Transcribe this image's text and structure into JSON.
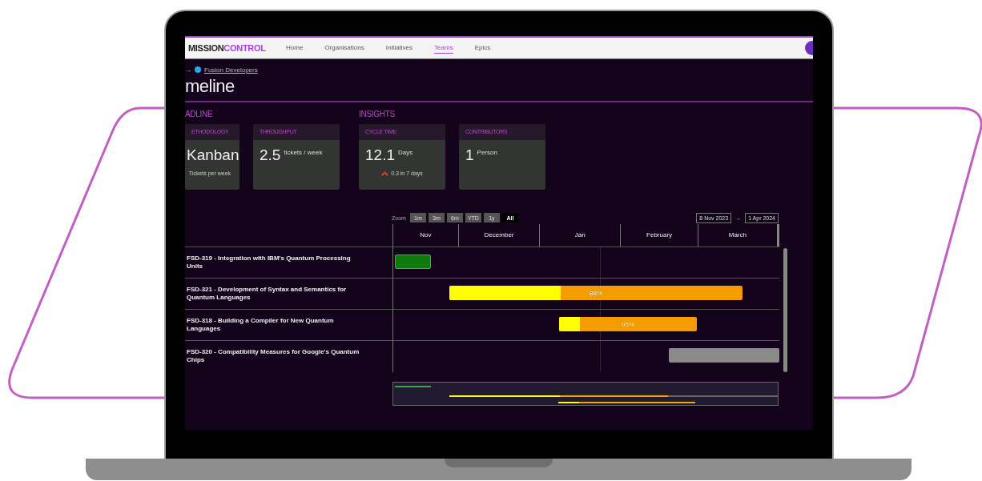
{
  "brand": {
    "first": "MISSION",
    "second": "CONTROL"
  },
  "nav": [
    {
      "label": "Home",
      "selected": false
    },
    {
      "label": "Organisations",
      "selected": false
    },
    {
      "label": "Initiatives",
      "selected": false
    },
    {
      "label": "Teams",
      "selected": true
    },
    {
      "label": "Epics",
      "selected": false
    }
  ],
  "breadcrumb": {
    "arrow": "→",
    "link": "Fusion Developers"
  },
  "page_title": "meline",
  "sections": [
    {
      "title": "ADLINE",
      "cards": [
        {
          "label": "ETHODOLOGY",
          "value": "Kanban",
          "note": "Tickets per week"
        },
        {
          "label": "THROUGHPUT",
          "value": "2.5",
          "unit": "tickets / week"
        }
      ]
    },
    {
      "title": "INSIGHTS",
      "cards": [
        {
          "label": "CYCLE TIME",
          "value": "12.1",
          "unit": "Days",
          "note": "0.3 in 7 days",
          "rising": true
        },
        {
          "label": "CONTRIBUTORS",
          "value": "1",
          "unit": "Person"
        }
      ]
    }
  ],
  "zoom": {
    "label": "Zoom",
    "options": [
      {
        "label": "1m",
        "selected": false
      },
      {
        "label": "3m",
        "selected": false
      },
      {
        "label": "6m",
        "selected": false
      },
      {
        "label": "YTD",
        "selected": false
      },
      {
        "label": "1y",
        "selected": false
      },
      {
        "label": "All",
        "selected": true
      }
    ]
  },
  "date_range": {
    "from": "8 Nov 2023",
    "arrow": "→",
    "to": "1 Apr 2024"
  },
  "months": [
    "Nov",
    "December",
    "Jan",
    "February",
    "March"
  ],
  "tasks": [
    {
      "title": "FSD-319 - Integration with IBM's Quantum Processing Units",
      "kind": "done"
    },
    {
      "title": "FSD-321 - Development of Syntax and Semantics for Quantum Languages",
      "kind": "in_progress",
      "level": 0.38,
      "label": "88%"
    },
    {
      "title": "FSD-318 - Building a Compiler for New Quantum Languages",
      "kind": "in_progress",
      "level": 0.15,
      "label": "95%"
    },
    {
      "title": "FSD-320 - Compatibility Measures for Google's Quantum Chips",
      "kind": "todo"
    }
  ]
}
